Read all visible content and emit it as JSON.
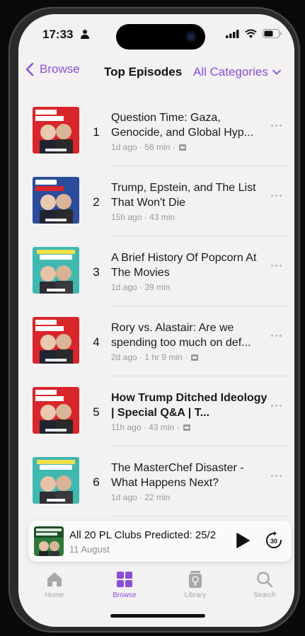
{
  "status_bar": {
    "time": "17:33"
  },
  "nav": {
    "back_label": "Browse",
    "title": "Top Episodes",
    "categories_label": "All Categories"
  },
  "episodes": [
    {
      "rank": "1",
      "title": "Question Time: Gaza, Genocide, and Global Hyp...",
      "meta": "1d ago · 56 min ·",
      "bold": false,
      "art": "best-politics",
      "art_label": "The Rest Is Politics"
    },
    {
      "rank": "2",
      "title": "Trump, Epstein, and The List That Won't Die",
      "meta": "15h ago · 43 min",
      "bold": false,
      "art": "politics-us",
      "art_label": "The Rest Is Politics US"
    },
    {
      "rank": "3",
      "title": "A Brief History Of Popcorn At The Movies",
      "meta": "1d ago · 39 min",
      "bold": false,
      "art": "entertainment",
      "art_label": "The Rest Is Entertainment"
    },
    {
      "rank": "4",
      "title": "Rory vs. Alastair: Are we spending too much on def...",
      "meta": "2d ago · 1 hr 9 min ·",
      "bold": false,
      "art": "best-politics",
      "art_label": "The Rest Is Politics"
    },
    {
      "rank": "5",
      "title": "How Trump Ditched Ideology | Special Q&A | T...",
      "meta": "11h ago · 43 min ·",
      "bold": true,
      "art": "best-politics",
      "art_label": "The Rest Is Politics"
    },
    {
      "rank": "6",
      "title": "The MasterChef Disaster - What Happens Next?",
      "meta": "1d ago · 22 min",
      "bold": false,
      "art": "entertainment",
      "art_label": "The Rest Is Entertainment"
    }
  ],
  "mini_player": {
    "title": "All 20 PL Clubs Predicted: 25/2",
    "subtitle": "11 August",
    "art_label": "The Rest Is Football"
  },
  "tabs": [
    {
      "label": "Home",
      "icon": "house-icon",
      "active": false
    },
    {
      "label": "Browse",
      "icon": "grid-icon",
      "active": true
    },
    {
      "label": "Library",
      "icon": "library-icon",
      "active": false
    },
    {
      "label": "Search",
      "icon": "search-icon",
      "active": false
    }
  ],
  "colors": {
    "accent": "#8a4fd8",
    "politics_red": "#d8262b",
    "politics_blue": "#2c4c9c",
    "entertainment_teal": "#3fb9b0",
    "background": "#f3f1f2"
  }
}
